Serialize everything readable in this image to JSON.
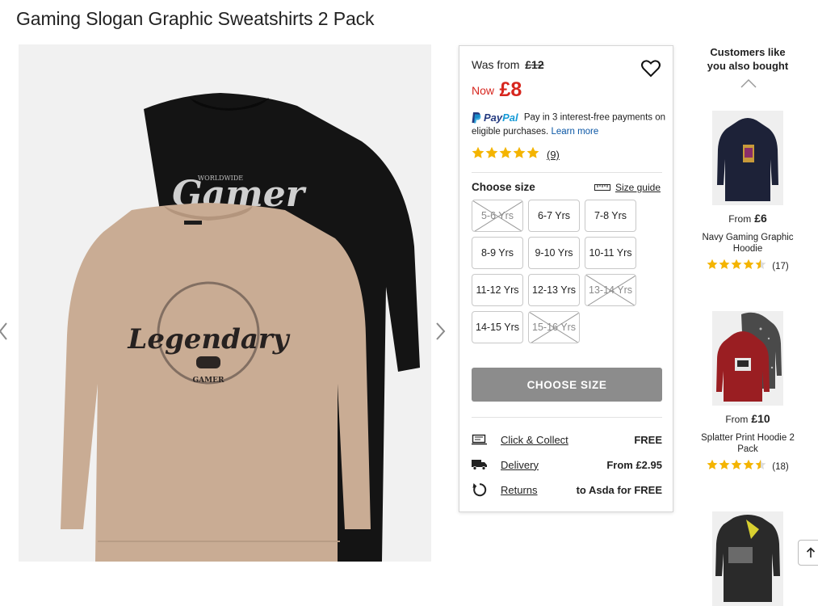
{
  "page_title": "Gaming Slogan Graphic Sweatshirts 2 Pack",
  "gallery": {
    "front_print_main": "Legendary",
    "front_print_sub": "GAMER",
    "back_print_small": "WORLDWIDE",
    "back_print_main": "Gamer"
  },
  "price": {
    "was_label": "Was from",
    "was_value": "£12",
    "now_label": "Now",
    "now_value": "£8"
  },
  "paypal": {
    "logo_word_1": "Pay",
    "logo_word_2": "Pal",
    "text": "Pay in 3 interest-free payments on eligible purchases.",
    "learn_more": "Learn more"
  },
  "rating": {
    "stars": 5,
    "count": "(9)"
  },
  "size_section": {
    "label": "Choose size",
    "guide_label": "Size guide",
    "sizes": [
      {
        "label": "5-6 Yrs",
        "available": false
      },
      {
        "label": "6-7 Yrs",
        "available": true
      },
      {
        "label": "7-8 Yrs",
        "available": true
      },
      {
        "label": "8-9 Yrs",
        "available": true
      },
      {
        "label": "9-10 Yrs",
        "available": true
      },
      {
        "label": "10-11 Yrs",
        "available": true
      },
      {
        "label": "11-12 Yrs",
        "available": true
      },
      {
        "label": "12-13 Yrs",
        "available": true
      },
      {
        "label": "13-14 Yrs",
        "available": false
      },
      {
        "label": "14-15 Yrs",
        "available": true
      },
      {
        "label": "15-16 Yrs",
        "available": false
      }
    ]
  },
  "choose_button": "CHOOSE SIZE",
  "fulfilment": [
    {
      "label": "Click & Collect",
      "value": "FREE",
      "icon": "click-collect-icon"
    },
    {
      "label": "Delivery",
      "value": "From £2.95",
      "icon": "delivery-truck-icon"
    },
    {
      "label": "Returns",
      "value": "to Asda for FREE",
      "icon": "returns-icon"
    }
  ],
  "recommendations": {
    "title": "Customers like you also bought",
    "items": [
      {
        "from": "From",
        "price": "£6",
        "name": "Navy Gaming Graphic Hoodie",
        "rating": 4.5,
        "count": "(17)",
        "colors": [
          "#1d2238",
          "#1d2238"
        ]
      },
      {
        "from": "From",
        "price": "£10",
        "name": "Splatter Print Hoodie 2 Pack",
        "rating": 4.5,
        "count": "(18)",
        "colors": [
          "#9a1e22",
          "#4a4a4a"
        ]
      },
      {
        "from": "",
        "price": "",
        "name": "",
        "rating": 0,
        "count": "",
        "colors": [
          "#2a2a2a",
          "#6a6a6a"
        ]
      }
    ]
  },
  "colors": {
    "sale_red": "#d7261e",
    "star_gold": "#f4b400",
    "button_grey": "#8c8c8c",
    "link_blue": "#0a56a5"
  }
}
